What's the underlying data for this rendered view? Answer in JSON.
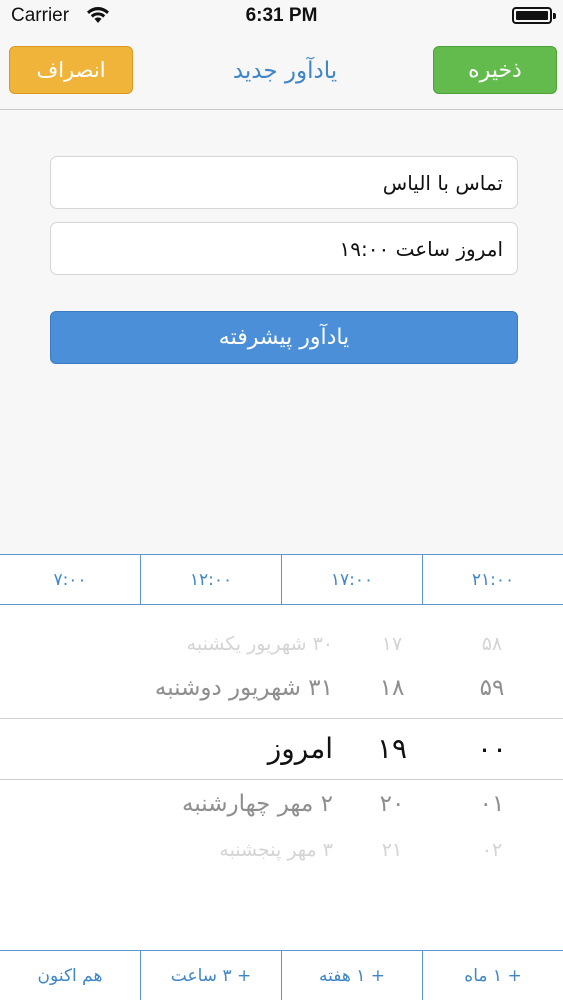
{
  "status_bar": {
    "carrier": "Carrier",
    "time": "6:31 PM",
    "battery_level": 1.0
  },
  "nav": {
    "title": "یادآور جدید",
    "cancel_label": "انصراف",
    "save_label": "ذخیره"
  },
  "form": {
    "title_value": "تماس با الیاس",
    "date_value": "امروز ساعت ۱۹:۰۰",
    "advanced_label": "یادآور پیشرفته"
  },
  "quick_times": [
    "۷:۰۰",
    "۱۲:۰۰",
    "۱۷:۰۰",
    "۲۱:۰۰"
  ],
  "picker": {
    "rows": [
      {
        "day": "۳۰ شهریور یکشنبه",
        "hour": "۱۷",
        "minute": "۵۸"
      },
      {
        "day": "۳۱ شهریور دوشنبه",
        "hour": "۱۸",
        "minute": "۵۹"
      },
      {
        "day": "امروز",
        "hour": "۱۹",
        "minute": "۰۰"
      },
      {
        "day": "۲ مهر چهارشنبه",
        "hour": "۲۰",
        "minute": "۰۱"
      },
      {
        "day": "۳ مهر پنجشنبه",
        "hour": "۲۱",
        "minute": "۰۲"
      }
    ]
  },
  "quick_adds": [
    "هم اکنون",
    "+ ۳ ساعت",
    "+ ۱ هفته",
    "+ ۱ ماه"
  ],
  "colors": {
    "cancel": "#f1b43a",
    "save": "#62bb4c",
    "accent_blue": "#3f86c8",
    "advanced_button": "#4a8fd8"
  },
  "icons": [
    "wifi-icon",
    "battery-icon"
  ]
}
